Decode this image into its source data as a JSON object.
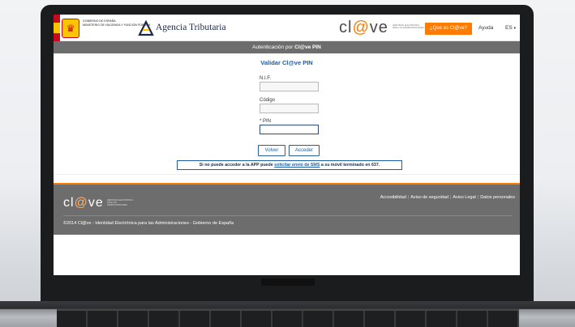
{
  "header": {
    "gov_logo_text": "Ministerio de Hacienda y Función Pública",
    "gov_label": "GOBIERNO DE ESPAÑA",
    "agency_name": "Agencia Tributaria",
    "clave_logo": {
      "prefix": "cl",
      "at": "@",
      "suffix": "ve"
    },
    "clave_subtitle": "Identidad electrónica para las Administraciones",
    "que_es_button": "¿Qué es Cl@ve?",
    "help_link": "Ayuda",
    "language": "ES"
  },
  "titlebar": {
    "prefix": "Autenticación por ",
    "brand": "Cl@ve PIN"
  },
  "form": {
    "title": "Validar Cl@ve PIN",
    "nif_label": "N.I.F.",
    "nif_value": "",
    "codigo_label": "Código",
    "codigo_value": "",
    "pin_label": "* PIN",
    "pin_value": "",
    "volver_button": "Volver",
    "acceder_button": "Acceder"
  },
  "notice": {
    "text_before": "Si no puede acceder a la APP puede ",
    "link": "solicitar envío de SMS",
    "text_after": " a su móvil terminado en 637."
  },
  "footer": {
    "logo": {
      "prefix": "cl",
      "at": "@",
      "suffix": "ve"
    },
    "subtitle": "Identidad electrónica para las Administraciones",
    "links": [
      "Accesibilidad",
      "Aviso de seguridad",
      "Aviso Legal",
      "Datos personales"
    ],
    "copyright": "©2014 Cl@ve - Identidad Electrónica para las Administraciones - Gobierno de España"
  },
  "colors": {
    "accent_orange": "#ff7a00",
    "link_blue": "#1a5fa8",
    "bar_gray": "#6d6d6d"
  },
  "icons": {
    "coat_of_arms": "spain-coat-of-arms-icon",
    "agency": "agencia-tributaria-icon",
    "language_dropdown": "chevron-down-icon"
  }
}
